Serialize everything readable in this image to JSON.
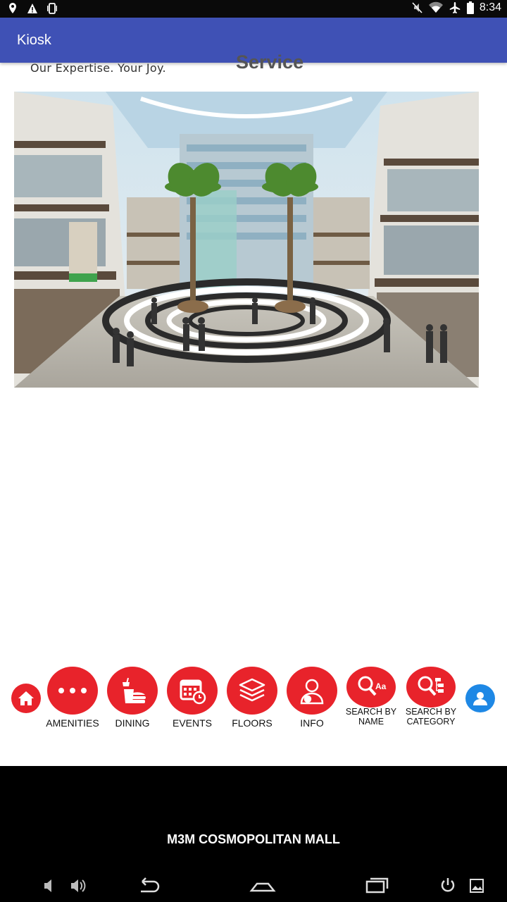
{
  "status_bar": {
    "time": "8:34",
    "icons": [
      "location-icon",
      "warning-icon",
      "vibrate-icon",
      "mute-icon",
      "wifi-icon",
      "airplane-icon",
      "battery-icon"
    ]
  },
  "app_bar": {
    "title": "Kiosk"
  },
  "banner": {
    "tagline": "Our Expertise. Your Joy.",
    "heading": "Service"
  },
  "hero": {
    "subject": "mall-atrium-image"
  },
  "nav": {
    "items": [
      {
        "label": "AMENITIES",
        "icon": "dots-icon"
      },
      {
        "label": "DINING",
        "icon": "food-icon"
      },
      {
        "label": "EVENTS",
        "icon": "calendar-icon"
      },
      {
        "label": "FLOORS",
        "icon": "layers-icon"
      },
      {
        "label": "INFO",
        "icon": "info-person-icon"
      },
      {
        "label_line1": "SEARCH BY",
        "label_line2": "NAME",
        "icon": "search-name-icon"
      },
      {
        "label_line1": "SEARCH BY",
        "label_line2": "CATEGORY",
        "icon": "search-category-icon"
      }
    ],
    "home_icon": "home-icon",
    "user_icon": "user-icon"
  },
  "footer": {
    "mall_name": "M3M COSMOPOLITAN MALL"
  },
  "colors": {
    "appbar": "#3f51b5",
    "nav_red": "#e8232b",
    "user_blue": "#1e88e5"
  }
}
